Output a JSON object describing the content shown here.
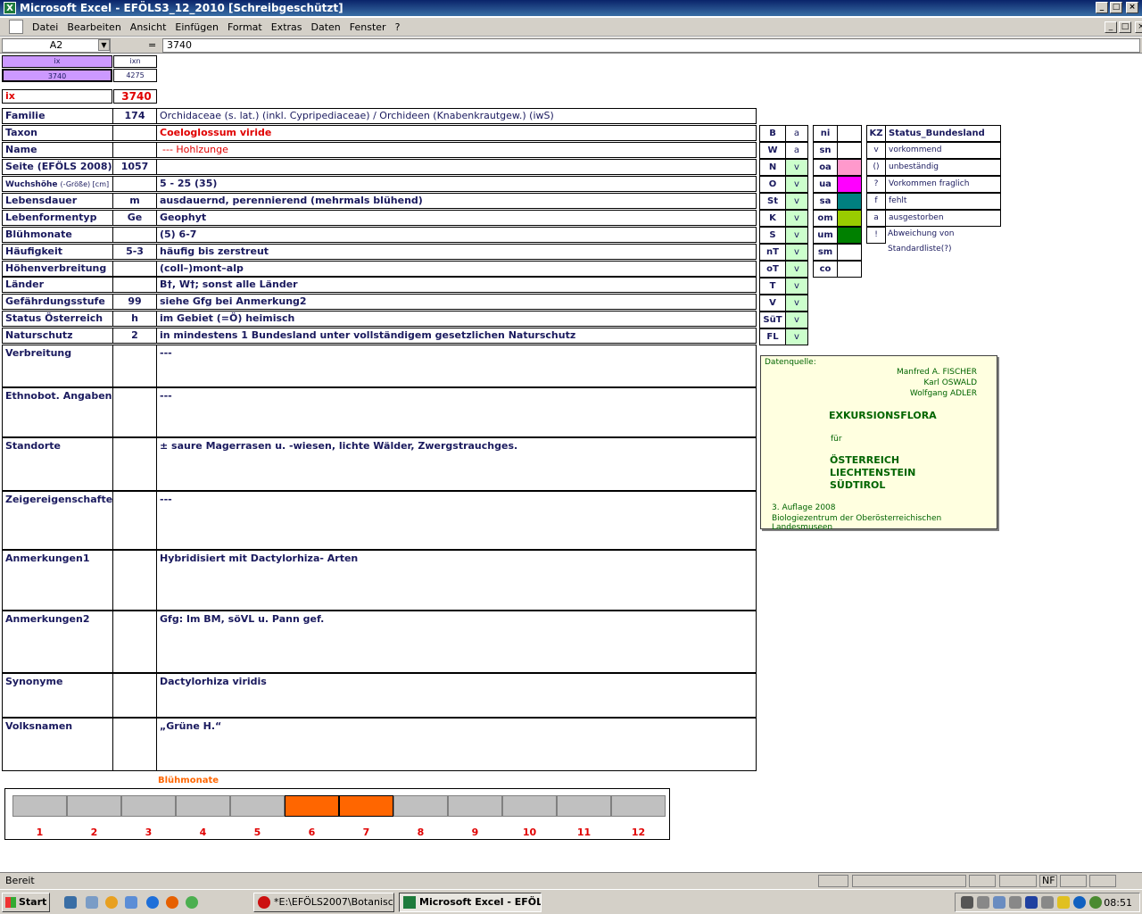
{
  "window": {
    "title": "Microsoft Excel - EFÖLS3_12_2010  [Schreibgeschützt]"
  },
  "menu": [
    "Datei",
    "Bearbeiten",
    "Ansicht",
    "Einfügen",
    "Format",
    "Extras",
    "Daten",
    "Fenster",
    "?"
  ],
  "formula": {
    "namebox": "A2",
    "equals": "=",
    "value": "3740"
  },
  "top": {
    "ix_hdr": "ix",
    "ixn_hdr": "ixn",
    "ix_val": "3740",
    "ixn_val": "4275",
    "ix_label": "ix",
    "ix_big": "3740"
  },
  "rows": [
    {
      "label": "Familie",
      "code": "174",
      "value": "Orchidaceae (s. lat.) (inkl. Cypripediaceae)  /  Orchideen (Knabenkrautgew.) (iwS)"
    },
    {
      "label": "Taxon",
      "code": "",
      "value": "Coeloglossum viride"
    },
    {
      "label": "Name",
      "code": "",
      "value": "--- Hohlzunge"
    },
    {
      "label": "Seite (EFÖLS 2008)",
      "code": "1057",
      "value": ""
    },
    {
      "label": "Wuchshöhe",
      "label_suffix": "(-Größe) [cm]",
      "code": "",
      "value": "5 - 25 (35)"
    },
    {
      "label": "Lebensdauer",
      "code": "m",
      "value": "ausdauernd, perennierend (mehrmals blühend)"
    },
    {
      "label": "Lebenformentyp",
      "code": "Ge",
      "value": "Geophyt"
    },
    {
      "label": "Blühmonate",
      "code": "",
      "value": "(5) 6-7"
    },
    {
      "label": "Häufigkeit",
      "code": "5-3",
      "value": "häufig bis zerstreut"
    },
    {
      "label": "Höhenverbreitung",
      "code": "",
      "value": "(coll–)mont–alp"
    },
    {
      "label": "Länder",
      "code": "",
      "value": "B†, W†; sonst alle Länder"
    },
    {
      "label": "Gefährdungsstufe",
      "code": "99",
      "value": "siehe Gfg bei Anmerkung2"
    },
    {
      "label": "Status Österreich",
      "code": "h",
      "value": "im Gebiet (=Ö) heimisch"
    },
    {
      "label": "Naturschutz",
      "code": "2",
      "value": "in mindestens 1 Bundesland unter vollständigem gesetzlichen Naturschutz"
    },
    {
      "label": "Verbreitung",
      "code": "",
      "value": "---"
    },
    {
      "label": "Ethnobot. Angaben",
      "code": "",
      "value": "---"
    },
    {
      "label": "Standorte",
      "code": "",
      "value": "± saure Magerrasen u. -wiesen, lichte Wälder, Zwergstrauchges."
    },
    {
      "label": "Zeigereigenschaften",
      "code": "",
      "value": "---"
    },
    {
      "label": "Anmerkungen1",
      "code": "",
      "value": "Hybridisiert mit Dactylorhiza- Arten"
    },
    {
      "label": "Anmerkungen2",
      "code": "",
      "value": "Gfg: Im BM, söVL u. Pann gef."
    },
    {
      "label": "Synonyme",
      "code": "",
      "value": "Dactylorhiza viridis"
    },
    {
      "label": "Volksnamen",
      "code": "",
      "value": "„Grüne H.“"
    }
  ],
  "regions": [
    {
      "k": "B",
      "v": "a"
    },
    {
      "k": "W",
      "v": "a"
    },
    {
      "k": "N",
      "v": "v"
    },
    {
      "k": "O",
      "v": "v"
    },
    {
      "k": "St",
      "v": "v"
    },
    {
      "k": "K",
      "v": "v"
    },
    {
      "k": "S",
      "v": "v"
    },
    {
      "k": "nT",
      "v": "v"
    },
    {
      "k": "oT",
      "v": "v"
    },
    {
      "k": "T",
      "v": "v"
    },
    {
      "k": "V",
      "v": "v"
    },
    {
      "k": "SüT",
      "v": "v"
    },
    {
      "k": "FL",
      "v": "v"
    }
  ],
  "zones": [
    {
      "k": "ni",
      "color": "#ffffff"
    },
    {
      "k": "sn",
      "color": "#ffffff"
    },
    {
      "k": "oa",
      "color": "#ff99cc"
    },
    {
      "k": "ua",
      "color": "#ff00ff"
    },
    {
      "k": "sa",
      "color": "#008080"
    },
    {
      "k": "om",
      "color": "#99cc00"
    },
    {
      "k": "um",
      "color": "#008000"
    },
    {
      "k": "sm",
      "color": "#ffffff"
    },
    {
      "k": "co",
      "color": "#ffffff"
    }
  ],
  "status": {
    "header_kz": "KZ",
    "header": "Status_Bundesland",
    "items": [
      {
        "k": "v",
        "t": "vorkommend"
      },
      {
        "k": "()",
        "t": "unbeständig"
      },
      {
        "k": "?",
        "t": "Vorkommen fraglich"
      },
      {
        "k": "f",
        "t": "fehlt"
      },
      {
        "k": "a",
        "t": "ausgestorben"
      },
      {
        "k": "!",
        "t": "Abweichung von Standardliste(?)"
      }
    ]
  },
  "info": {
    "label": "Datenquelle:",
    "authors": [
      "Manfred A. FISCHER",
      "Karl OSWALD",
      "Wolfgang ADLER"
    ],
    "title": "EXKURSIONSFLORA",
    "fuer": "für",
    "countries": [
      "ÖSTERREICH",
      "LIECHTENSTEIN",
      "SÜDTIROL"
    ],
    "edition": "3. Auflage 2008",
    "publisher": "Biologiezentrum der Oberösterreichischen Landesmuseen"
  },
  "bluehmonate": {
    "title": "Blühmonate",
    "months": [
      "1",
      "2",
      "3",
      "4",
      "5",
      "6",
      "7",
      "8",
      "9",
      "10",
      "11",
      "12"
    ],
    "active": [
      6,
      7
    ],
    "active_color": "#ff6600",
    "inactive_color": "#c0c0c0"
  },
  "statusbar": {
    "text": "Bereit",
    "nf": "NF"
  },
  "taskbar": {
    "start": "Start",
    "buttons": [
      "*E:\\EFÖLS2007\\Botanisc...",
      "Microsoft Excel - EFÖL..."
    ],
    "time": "08:51"
  }
}
